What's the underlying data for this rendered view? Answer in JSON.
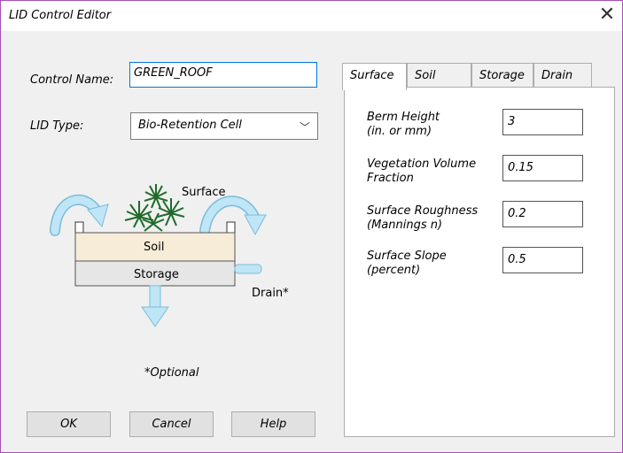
{
  "window": {
    "title": "LID Control Editor",
    "close_glyph": "✕"
  },
  "form": {
    "control_name_label": "Control Name:",
    "control_name_value": "GREEN_ROOF",
    "lid_type_label": "LID Type:",
    "lid_type_value": "Bio-Retention Cell"
  },
  "diagram": {
    "surface_label": "Surface",
    "soil_label": "Soil",
    "storage_label": "Storage",
    "drain_label": "Drain*",
    "optional_note": "*Optional"
  },
  "tabs": [
    {
      "label": "Surface",
      "active": true
    },
    {
      "label": "Soil",
      "active": false
    },
    {
      "label": "Storage",
      "active": false
    },
    {
      "label": "Drain",
      "active": false
    }
  ],
  "surface_fields": [
    {
      "label_line1": "Berm Height",
      "label_line2": "(in. or mm)",
      "value": "3"
    },
    {
      "label_line1": "Vegetation Volume",
      "label_line2": "Fraction",
      "value": "0.15"
    },
    {
      "label_line1": "Surface Roughness",
      "label_line2": "(Mannings n)",
      "value": "0.2"
    },
    {
      "label_line1": "Surface Slope",
      "label_line2": "(percent)",
      "value": "0.5"
    }
  ],
  "buttons": {
    "ok": "OK",
    "cancel": "Cancel",
    "help": "Help"
  },
  "colors": {
    "arrow": "#bfe6f7",
    "arrow_stroke": "#7bbbd9",
    "soil": "#f7ecd8",
    "storage": "#e6e6e6",
    "plants": "#1f6b2a"
  }
}
